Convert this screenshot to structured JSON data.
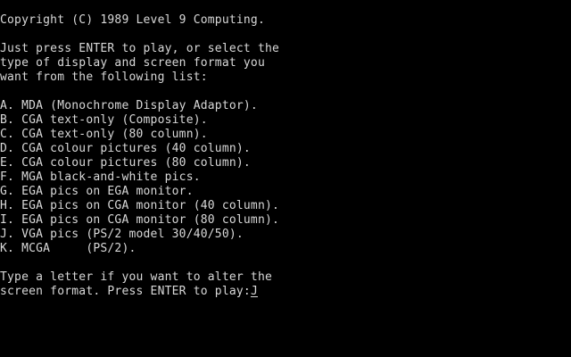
{
  "copyright": "Copyright (C) 1989 Level 9 Computing.",
  "intro": [
    "Just press ENTER to play, or select the",
    "type of display and screen format you",
    "want from the following list:"
  ],
  "options": [
    "A. MDA (Monochrome Display Adaptor).",
    "B. CGA text-only (Composite).",
    "C. CGA text-only (80 column).",
    "D. CGA colour pictures (40 column).",
    "E. CGA colour pictures (80 column).",
    "F. MGA black-and-white pics.",
    "G. EGA pics on EGA monitor.",
    "H. EGA pics on CGA monitor (40 column).",
    "I. EGA pics on CGA monitor (80 column).",
    "J. VGA pics (PS/2 model 30/40/50).",
    "K. MCGA     (PS/2)."
  ],
  "prompt": {
    "line1": "Type a letter if you want to alter the",
    "line2": "screen format. Press ENTER to play:",
    "input_value": "J"
  },
  "colors": {
    "background": "#000000",
    "text": "#d8d8d8"
  }
}
